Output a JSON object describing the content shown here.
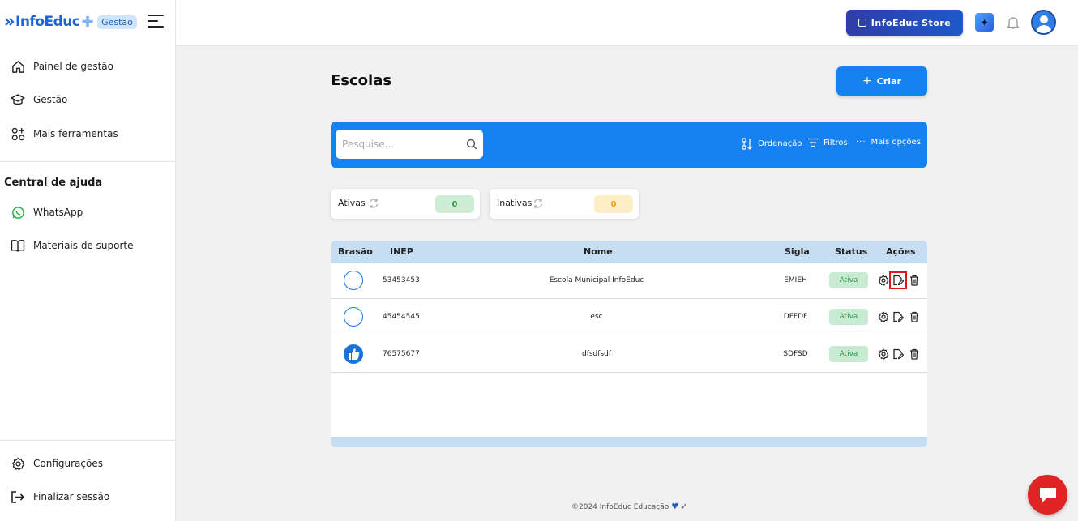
{
  "brand": {
    "name": "InfoEduc",
    "badge": "Gestão"
  },
  "sidebar": {
    "items": [
      {
        "label": "Painel de gestão"
      },
      {
        "label": "Gestão"
      },
      {
        "label": "Mais ferramentas"
      }
    ],
    "help_title": "Central de ajuda",
    "help_items": [
      {
        "label": "WhatsApp"
      },
      {
        "label": "Materiais de suporte"
      }
    ],
    "bottom_items": [
      {
        "label": "Configurações"
      },
      {
        "label": "Finalizar sessão"
      }
    ]
  },
  "topbar": {
    "store_label": "InfoEduc Store"
  },
  "main": {
    "title": "Escolas",
    "create_label": "Criar",
    "search_placeholder": "Pesquise...",
    "tools": {
      "sort": "Ordenação",
      "filters": "Filtros",
      "more": "Mais opções"
    },
    "counters": {
      "active_label": "Ativas",
      "active_value": "0",
      "inactive_label": "Inativas",
      "inactive_value": "0"
    },
    "table": {
      "headers": {
        "crest": "Brasão",
        "inep": "INEP",
        "name": "Nome",
        "acronym": "Sigla",
        "status": "Status",
        "actions": "Ações"
      },
      "rows": [
        {
          "inep": "53453453",
          "name": "Escola Municipal InfoEduc",
          "acronym": "EMIEH",
          "status": "Ativa"
        },
        {
          "inep": "45454545",
          "name": "esc",
          "acronym": "DFFDF",
          "status": "Ativa"
        },
        {
          "inep": "76575677",
          "name": "dfsdfsdf",
          "acronym": "SDFSD",
          "status": "Ativa"
        }
      ]
    }
  },
  "footer": {
    "text": "©2024 InfoEduc Educação"
  },
  "colors": {
    "primary": "#1681f0",
    "table_header": "#c6def4",
    "status_bg": "#c9ebd3",
    "status_text": "#2c9a4d",
    "chat": "#e02424"
  }
}
